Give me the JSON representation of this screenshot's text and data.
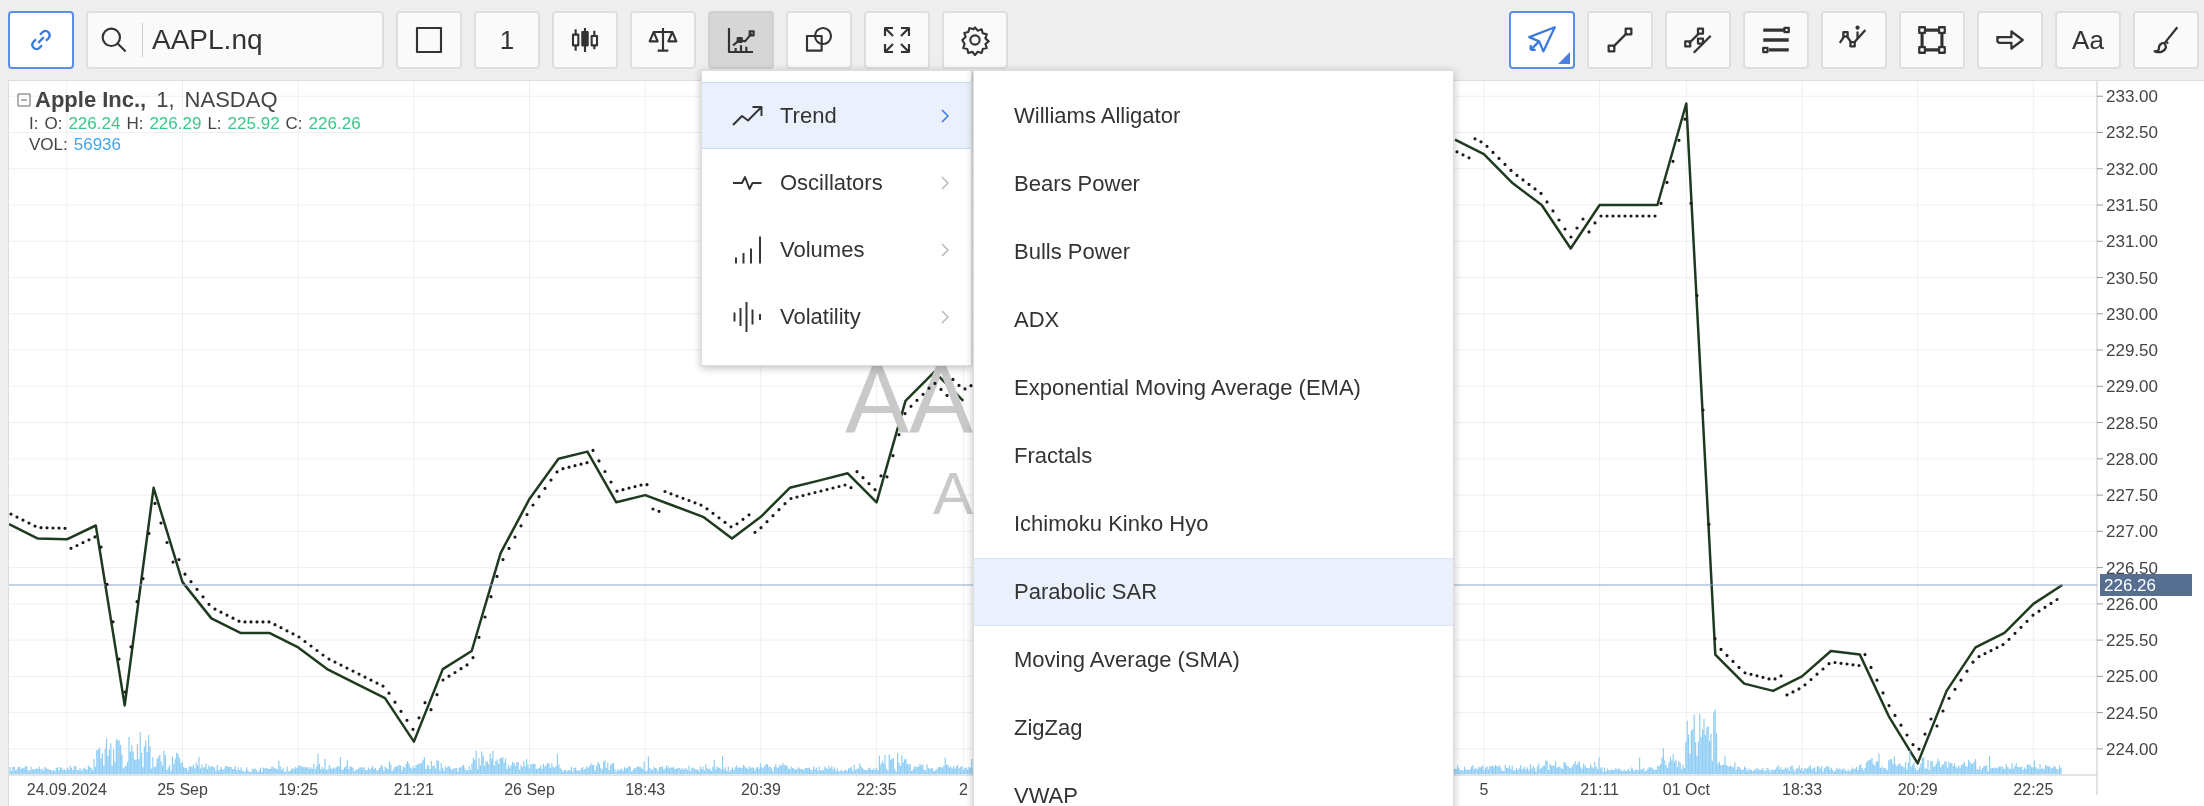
{
  "toolbar": {
    "sync_button": {
      "selected": true
    },
    "search": {
      "value": "AAPL.nq"
    },
    "buttons": [
      {
        "kind": "square",
        "open": false
      },
      {
        "kind": "interval",
        "label": "1",
        "open": false
      },
      {
        "kind": "candles",
        "open": false
      },
      {
        "kind": "compare",
        "open": false
      },
      {
        "kind": "indicators",
        "open": true
      },
      {
        "kind": "shapes",
        "open": false
      },
      {
        "kind": "fullscreen",
        "open": false
      },
      {
        "kind": "settings",
        "open": false
      }
    ],
    "drawing_tools": [
      {
        "kind": "cursor",
        "selected": true
      },
      {
        "kind": "trend-line",
        "selected": false
      },
      {
        "kind": "parallel",
        "selected": false
      },
      {
        "kind": "levels",
        "selected": false
      },
      {
        "kind": "note",
        "selected": false
      },
      {
        "kind": "rectangle",
        "selected": false
      },
      {
        "kind": "arrow",
        "selected": false
      },
      {
        "kind": "text",
        "label": "Aa",
        "selected": false
      },
      {
        "kind": "brush",
        "selected": false
      }
    ]
  },
  "chart": {
    "legend": {
      "name": "Apple Inc.,",
      "interval": "1,",
      "exchange": "NASDAQ",
      "prefix": "I:",
      "values": [
        {
          "label": "O:",
          "value": "226.24"
        },
        {
          "label": "H:",
          "value": "226.29"
        },
        {
          "label": "L:",
          "value": "225.92"
        },
        {
          "label": "C:",
          "value": "226.26"
        }
      ],
      "volume": {
        "label": "VOL:",
        "value": "56936"
      }
    },
    "watermark": {
      "symbol": "AA",
      "name": "A"
    },
    "chart_data": {
      "type": "line",
      "grid": true,
      "ref_lines": [
        {
          "axis": "y",
          "value": 226.26,
          "label": "226.26"
        }
      ],
      "categories": [
        null,
        null,
        "24.09.2024",
        null,
        null,
        null,
        "25 Sep",
        null,
        null,
        null,
        "19:25",
        null,
        null,
        null,
        "21:21",
        null,
        null,
        null,
        "26 Sep",
        null,
        null,
        null,
        "18:43",
        null,
        null,
        null,
        "20:39",
        null,
        null,
        null,
        "22:35",
        null,
        null,
        "2",
        null,
        null,
        null,
        null,
        null,
        null,
        null,
        null,
        null,
        null,
        null,
        null,
        null,
        null,
        null,
        null,
        null,
        "5",
        null,
        null,
        null,
        "21:11",
        null,
        null,
        "01 Oct",
        null,
        null,
        null,
        "18:33",
        null,
        null,
        null,
        "20:29",
        null,
        null,
        null,
        "22:25",
        null
      ],
      "series": [
        {
          "color": "#1f3a1f",
          "values": [
            227.1,
            226.9,
            226.89,
            227.08,
            224.6,
            227.6,
            226.3,
            225.8,
            225.6,
            225.6,
            225.4,
            225.1,
            224.9,
            224.7,
            224.1,
            225.1,
            225.35,
            226.7,
            227.45,
            228.0,
            228.1,
            227.4,
            227.5,
            227.35,
            227.2,
            226.9,
            227.2,
            227.6,
            227.7,
            227.8,
            227.4,
            228.8,
            229.2,
            228.8,
            null,
            null,
            null,
            null,
            null,
            null,
            null,
            null,
            null,
            null,
            null,
            null,
            null,
            null,
            null,
            null,
            232.4,
            232.2,
            231.8,
            231.5,
            230.9,
            231.5,
            231.5,
            231.5,
            232.9,
            225.3,
            224.9,
            224.8,
            225.0,
            225.35,
            225.3,
            224.45,
            223.8,
            224.8,
            225.4,
            225.6,
            226.0,
            226.26
          ]
        }
      ],
      "ylim": [
        223.64,
        233.21
      ],
      "yticks": [
        {
          "value": 233,
          "label": "233.00"
        },
        {
          "value": 232.5,
          "label": "232.50"
        },
        {
          "value": 232,
          "label": "232.00"
        },
        {
          "value": 231.5,
          "label": "231.50"
        },
        {
          "value": 231,
          "label": "231.00"
        },
        {
          "value": 230.5,
          "label": "230.50"
        },
        {
          "value": 230,
          "label": "230.00"
        },
        {
          "value": 229.5,
          "label": "229.50"
        },
        {
          "value": 229,
          "label": "229.00"
        },
        {
          "value": 228.5,
          "label": "228.50"
        },
        {
          "value": 228,
          "label": "228.00"
        },
        {
          "value": 227.5,
          "label": "227.50"
        },
        {
          "value": 227,
          "label": "227.00"
        },
        {
          "value": 226.5,
          "label": "226.50"
        },
        {
          "value": 226,
          "label": "226.00"
        },
        {
          "value": 225.5,
          "label": "225.50"
        },
        {
          "value": 225,
          "label": "225.00"
        },
        {
          "value": 224.5,
          "label": "224.50"
        },
        {
          "value": 224,
          "label": "224.00"
        }
      ]
    }
  },
  "indicator_menu": {
    "categories": [
      {
        "kind": "trend",
        "label": "Trend",
        "selected": true
      },
      {
        "kind": "oscillators",
        "label": "Oscillators",
        "selected": false
      },
      {
        "kind": "volumes",
        "label": "Volumes",
        "selected": false
      },
      {
        "kind": "volatility",
        "label": "Volatility",
        "selected": false
      }
    ],
    "items": [
      {
        "label": "Williams Alligator",
        "selected": false
      },
      {
        "label": "Bears Power",
        "selected": false
      },
      {
        "label": "Bulls Power",
        "selected": false
      },
      {
        "label": "ADX",
        "selected": false
      },
      {
        "label": "Exponential Moving Average (EMA)",
        "selected": false
      },
      {
        "label": "Fractals",
        "selected": false
      },
      {
        "label": "Ichimoku Kinko Hyo",
        "selected": false
      },
      {
        "label": "Parabolic SAR",
        "selected": true
      },
      {
        "label": "Moving Average (SMA)",
        "selected": false
      },
      {
        "label": "ZigZag",
        "selected": false
      },
      {
        "label": "VWAP",
        "selected": false
      }
    ]
  }
}
